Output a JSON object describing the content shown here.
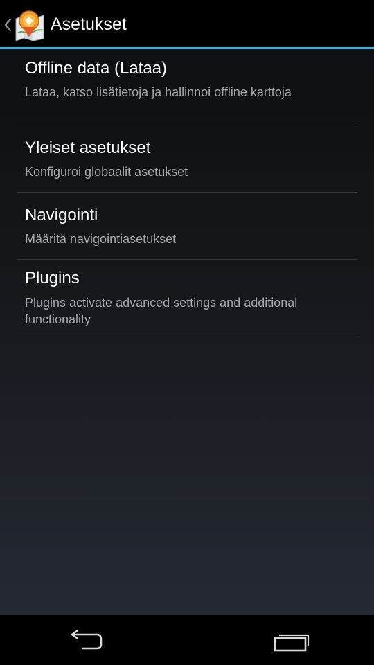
{
  "action_bar": {
    "title": "Asetukset",
    "accent_color": "#33b5e5",
    "up_icon": "chevron-left-icon",
    "app_icon": "map-pin-app-icon"
  },
  "preferences": [
    {
      "title": "Offline data (Lataa)",
      "summary": "Lataa, katso lisätietoja ja hallinnoi offline karttoja"
    },
    {
      "title": "Yleiset asetukset",
      "summary": "Konfiguroi globaalit asetukset"
    },
    {
      "title": "Navigointi",
      "summary": "Määritä navigointiasetukset"
    },
    {
      "title": "Plugins",
      "summary": "Plugins activate advanced settings and additional functionality"
    }
  ],
  "nav_bar": {
    "back_icon": "back-arrow-icon",
    "recents_icon": "recent-apps-icon"
  }
}
